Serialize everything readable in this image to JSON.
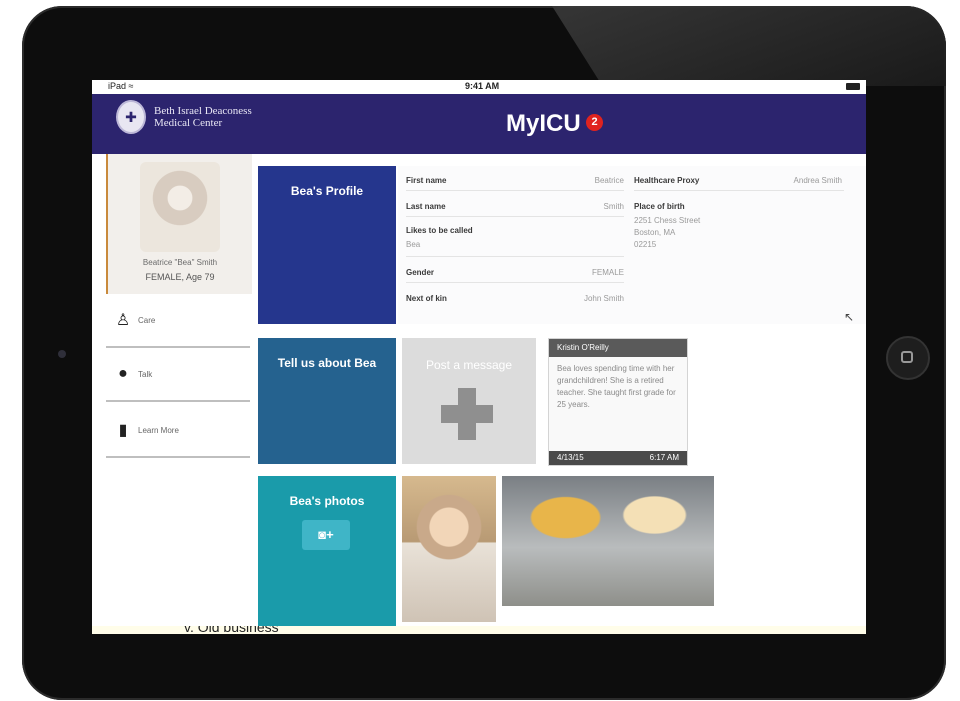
{
  "statusbar": {
    "carrier": "iPad ≈",
    "time": "9:41 AM"
  },
  "header": {
    "org_name_line1": "Beth Israel Deaconess",
    "org_name_line2": "Medical Center",
    "app_title": "MyICU",
    "notification_count": "2"
  },
  "patient": {
    "name": "Beatrice \"Bea\" Smith",
    "meta": "FEMALE, Age 79"
  },
  "sidebar": {
    "items": [
      {
        "label": "Care",
        "icon": "nurse-icon"
      },
      {
        "label": "Talk",
        "icon": "chat-bubbles-icon"
      },
      {
        "label": "Learn More",
        "icon": "book-icon"
      }
    ]
  },
  "tiles": {
    "profile": "Bea's Profile",
    "tell": "Tell us about Bea",
    "photos": "Bea's photos"
  },
  "profile": {
    "first_name_label": "First name",
    "first_name": "Beatrice",
    "last_name_label": "Last name",
    "last_name": "Smith",
    "likes_label": "Likes to be called",
    "likes": "Bea",
    "gender_label": "Gender",
    "gender": "FEMALE",
    "kin_label": "Next of kin",
    "kin": "John Smith",
    "proxy_label": "Healthcare Proxy",
    "proxy": "Andrea Smith",
    "birth_label": "Place of birth",
    "birth_line1": "2251 Chess Street",
    "birth_line2": "Boston, MA",
    "birth_line3": "02215"
  },
  "post": {
    "label": "Post a message"
  },
  "message": {
    "author": "Kristin O'Reilly",
    "text": "Bea loves spending time with her grandchildren! She is a retired teacher.  She taught first grade for 25 years.",
    "date": "4/13/15",
    "time": "6:17 AM"
  },
  "footer_bleed": "v.  Old business",
  "colors": {
    "header_bg": "#2c246e",
    "profile_tile": "#25368d",
    "tell_tile": "#25628f",
    "photos_tile": "#1a9baa",
    "badge": "#e0231f"
  }
}
